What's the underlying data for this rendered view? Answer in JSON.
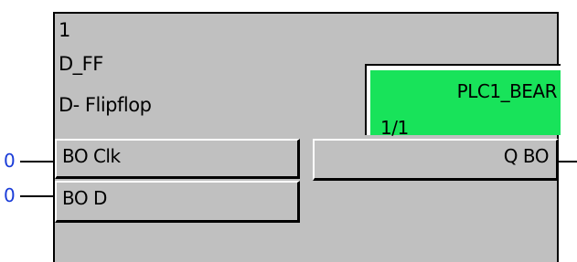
{
  "block": {
    "number": "1",
    "type": "D_FF",
    "description": "D- Flipflop"
  },
  "plc": {
    "name": "PLC1_BEAR",
    "page": "1/1",
    "color": "#18e35a"
  },
  "inputs": [
    {
      "label": "BO Clk",
      "value": "0"
    },
    {
      "label": "BO D",
      "value": "0"
    }
  ],
  "outputs": [
    {
      "label": "Q BO"
    }
  ],
  "colors": {
    "block_bg": "#c0c0c0",
    "pin_value": "#1a3cd8"
  }
}
